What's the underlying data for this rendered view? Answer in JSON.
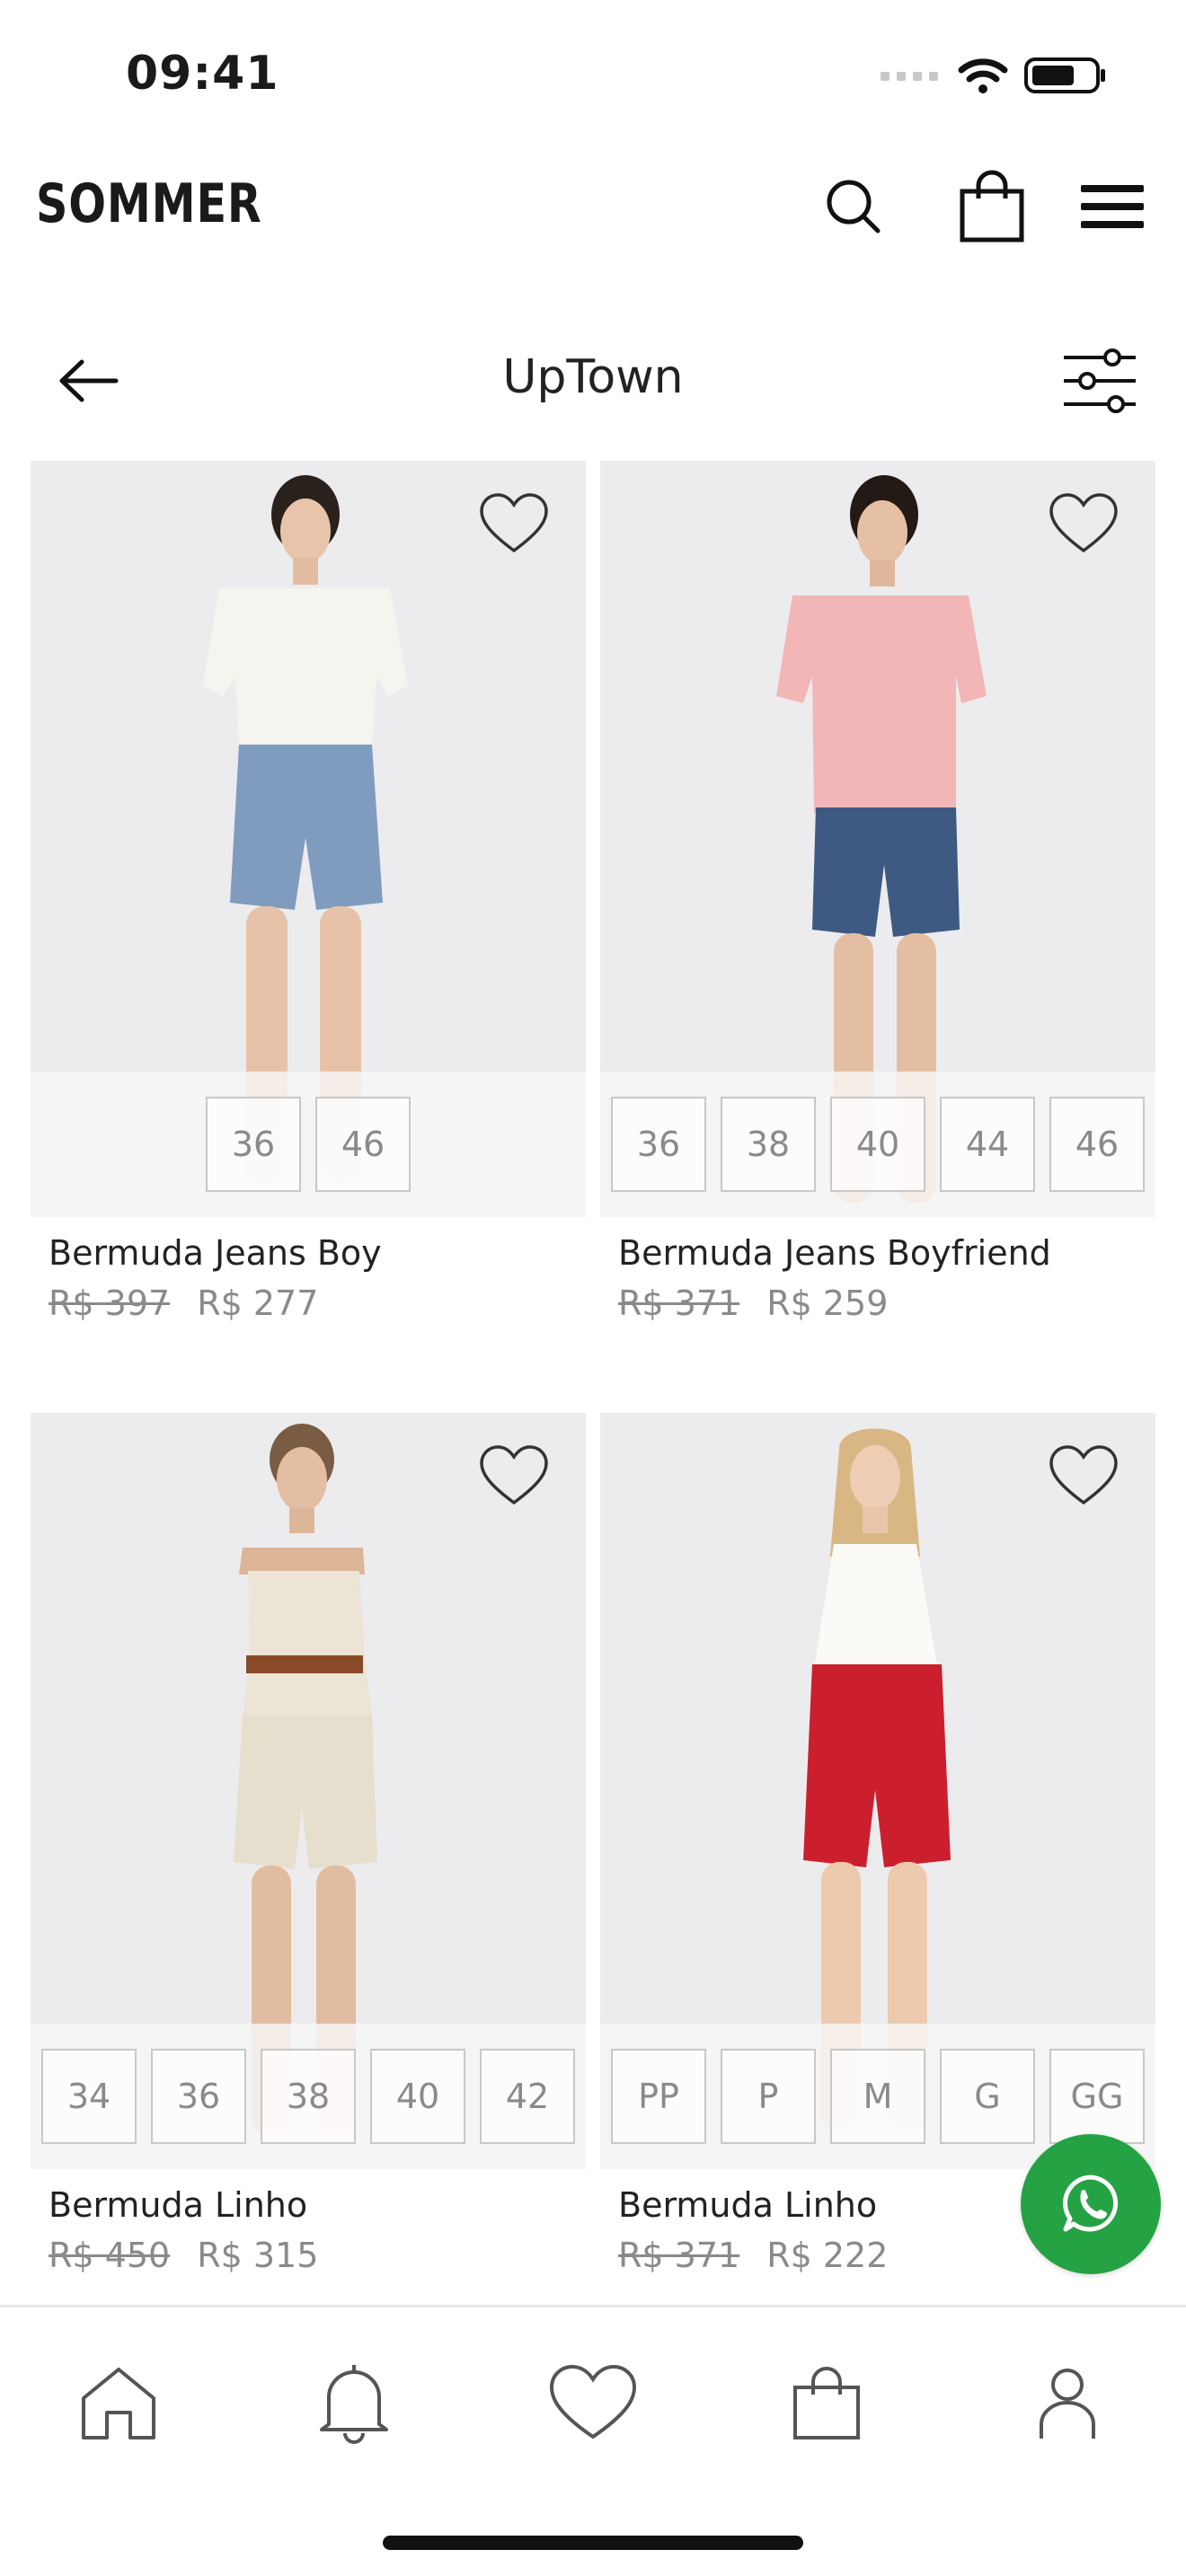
{
  "status_bar": {
    "time": "09:41"
  },
  "header": {
    "brand": "SOMMER"
  },
  "sub_header": {
    "title": "UpTown"
  },
  "products": [
    {
      "name": "Bermuda Jeans Boy",
      "old_price": "R$ 397",
      "price": "R$ 277",
      "sizes": [
        "36",
        "46"
      ],
      "colors": {
        "top": "#f6f4ef",
        "bottom": "#7f9cbf"
      }
    },
    {
      "name": "Bermuda Jeans Boyfriend",
      "old_price": "R$ 371",
      "price": "R$ 259",
      "sizes": [
        "36",
        "38",
        "40",
        "44",
        "46"
      ],
      "colors": {
        "top": "#f2b6b6",
        "bottom": "#3e5a82"
      }
    },
    {
      "name": "Bermuda Linho",
      "old_price": "R$ 450",
      "price": "R$ 315",
      "sizes": [
        "34",
        "36",
        "38",
        "40",
        "42"
      ],
      "colors": {
        "top": "#ece4d4",
        "bottom": "#e7dfcd"
      }
    },
    {
      "name": "Bermuda Linho",
      "old_price": "R$ 371",
      "price": "R$ 222",
      "sizes": [
        "PP",
        "P",
        "M",
        "G",
        "GG"
      ],
      "colors": {
        "top": "#fbfaf6",
        "bottom": "#cc1f2e"
      }
    }
  ],
  "theme": {
    "whatsapp_green": "#25a243",
    "text": "#1a1a1a",
    "muted": "#8a8a8a",
    "image_bg": "#ececee"
  },
  "icons": {
    "header": [
      "search-icon",
      "shopping-bag-icon",
      "menu-icon"
    ],
    "sub_header": [
      "back-arrow-icon",
      "filter-sliders-icon"
    ],
    "card": "heart-outline-icon",
    "floating": "whatsapp-icon",
    "bottom_nav": [
      "home-icon",
      "bell-icon",
      "heart-icon",
      "bag-icon",
      "user-icon"
    ]
  }
}
